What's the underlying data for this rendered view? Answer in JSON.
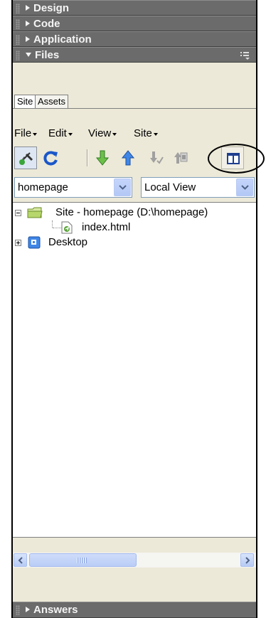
{
  "panels": {
    "design": "Design",
    "code": "Code",
    "application": "Application",
    "files": "Files",
    "answers": "Answers"
  },
  "tabs": [
    "Site",
    "Assets"
  ],
  "menus": [
    "File",
    "Edit",
    "View",
    "Site"
  ],
  "toolbar": {
    "icons": [
      "connect-icon",
      "refresh-icon",
      "get-files-icon",
      "put-files-icon",
      "check-out-icon",
      "check-in-icon",
      "expand-icon"
    ]
  },
  "site_select": {
    "value": "homepage"
  },
  "view_select": {
    "value": "Local View"
  },
  "tree": {
    "root": "Site - homepage (D:\\homepage)",
    "child": "index.html",
    "desktop": "Desktop"
  },
  "colors": {
    "header_bg": "#6b6b6b",
    "panel_bg": "#ece9d8",
    "select_border": "#7f9db9",
    "dropdown_button": "#b3c8f5"
  }
}
